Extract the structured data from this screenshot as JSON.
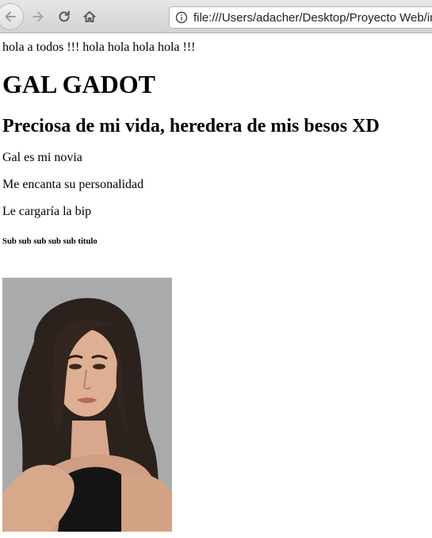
{
  "browser": {
    "url": "file:///Users/adacher/Desktop/Proyecto Web/index.html"
  },
  "page": {
    "intro_text": "hola a todos !!! hola hola hola hola !!!",
    "heading1": "GAL GADOT",
    "heading2": "Preciosa de mi vida, heredera de mis besos XD",
    "paragraphs": [
      "Gal es mi novia",
      "Me encanta su personalidad",
      "Le cargaría la bip"
    ],
    "heading6": "Sub sub sub sub sub titulo",
    "image": {
      "subject": "portrait photo of a woman with long dark hair",
      "background_color": "#a9aaac"
    }
  },
  "icons": {
    "back": "arrow-left-icon",
    "forward": "arrow-right-icon",
    "reload": "reload-icon",
    "home": "home-icon",
    "info": "info-icon"
  }
}
